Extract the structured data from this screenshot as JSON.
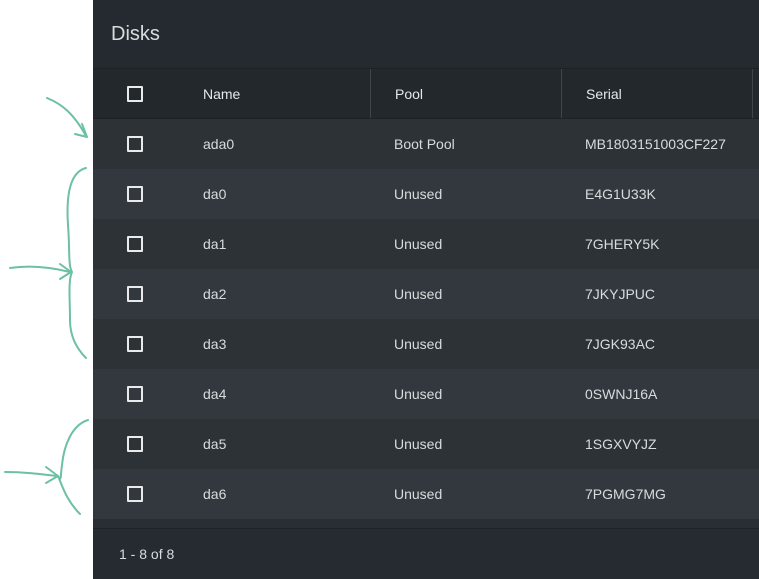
{
  "panel": {
    "title": "Disks"
  },
  "table": {
    "columns": [
      "Name",
      "Pool",
      "Serial"
    ],
    "rows": [
      {
        "name": "ada0",
        "pool": "Boot Pool",
        "serial": "MB1803151003CF227"
      },
      {
        "name": "da0",
        "pool": "Unused",
        "serial": "E4G1U33K"
      },
      {
        "name": "da1",
        "pool": "Unused",
        "serial": "7GHERY5K"
      },
      {
        "name": "da2",
        "pool": "Unused",
        "serial": "7JKYJPUC"
      },
      {
        "name": "da3",
        "pool": "Unused",
        "serial": "7JGK93AC"
      },
      {
        "name": "da4",
        "pool": "Unused",
        "serial": "0SWNJ16A"
      },
      {
        "name": "da5",
        "pool": "Unused",
        "serial": "1SGXVYJZ"
      },
      {
        "name": "da6",
        "pool": "Unused",
        "serial": "7PGMG7MG"
      }
    ]
  },
  "footer": {
    "range": "1 - 8 of 8"
  },
  "colors": {
    "panel_bg": "#282e33",
    "annotation_ink": "#6cc0a4"
  },
  "icons": {
    "annotations": [
      "arrow-icon",
      "brace-icon"
    ]
  }
}
